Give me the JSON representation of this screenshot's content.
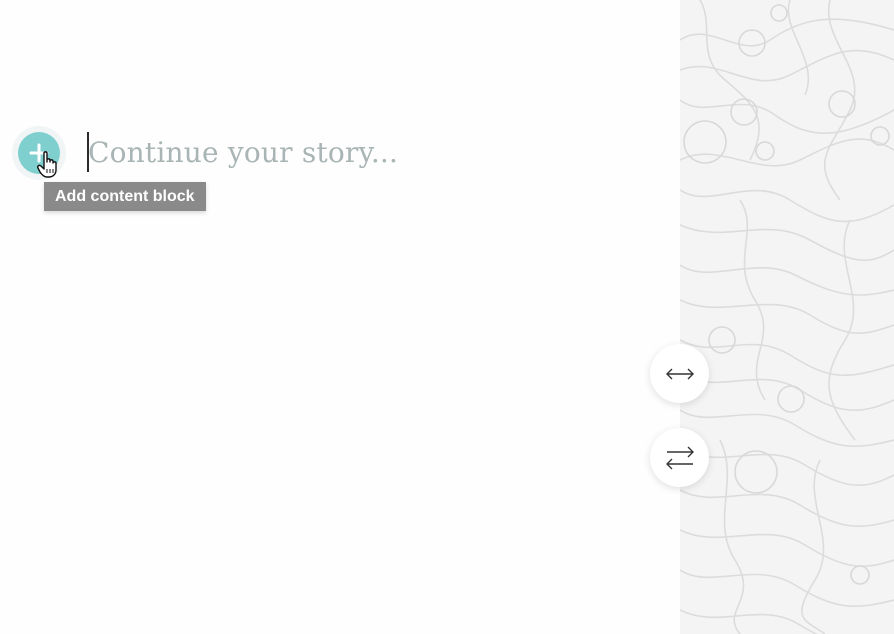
{
  "editor": {
    "placeholder": "Continue your story...",
    "add_button_icon": "plus-icon",
    "add_tooltip": "Add content block",
    "accent_color": "#7fcfcf"
  },
  "side_controls": {
    "resize_icon": "double-arrow-horizontal-icon",
    "swap_icon": "swap-arrows-icon"
  },
  "background": {
    "pattern": "topographic-contour-lines",
    "panel_color": "#f4f4f4"
  }
}
